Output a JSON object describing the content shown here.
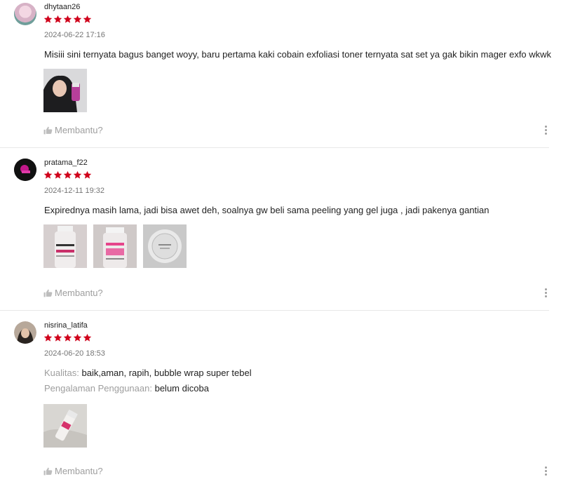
{
  "reviews": [
    {
      "username": "dhytaan26",
      "rating": 5,
      "date": "2024-06-22 17:16",
      "comment": "Misiii sini ternyata bagus banget woyy, baru pertama kaki cobain exfoliasi toner ternyata sat set ya gak bikin mager exfo wkwk",
      "helpful_label": "Membantu?"
    },
    {
      "username": "pratama_f22",
      "rating": 5,
      "date": "2024-12-11 19:32",
      "comment": "Expirednya masih lama, jadi bisa awet deh, soalnya gw beli sama peeling yang gel juga , jadi pakenya gantian",
      "helpful_label": "Membantu?"
    },
    {
      "username": "nisrina_latifa",
      "rating": 5,
      "date": "2024-06-20 18:53",
      "attributes": [
        {
          "key": "Kualitas:",
          "value": "baik,aman, rapih, bubble wrap super tebel"
        },
        {
          "key": "Pengalaman Penggunaan:",
          "value": "belum dicoba"
        }
      ],
      "helpful_label": "Membantu?"
    }
  ],
  "colors": {
    "star": "#d0011b",
    "muted": "#9e9e9e",
    "text": "#222222",
    "divider": "#e8e8e8"
  }
}
